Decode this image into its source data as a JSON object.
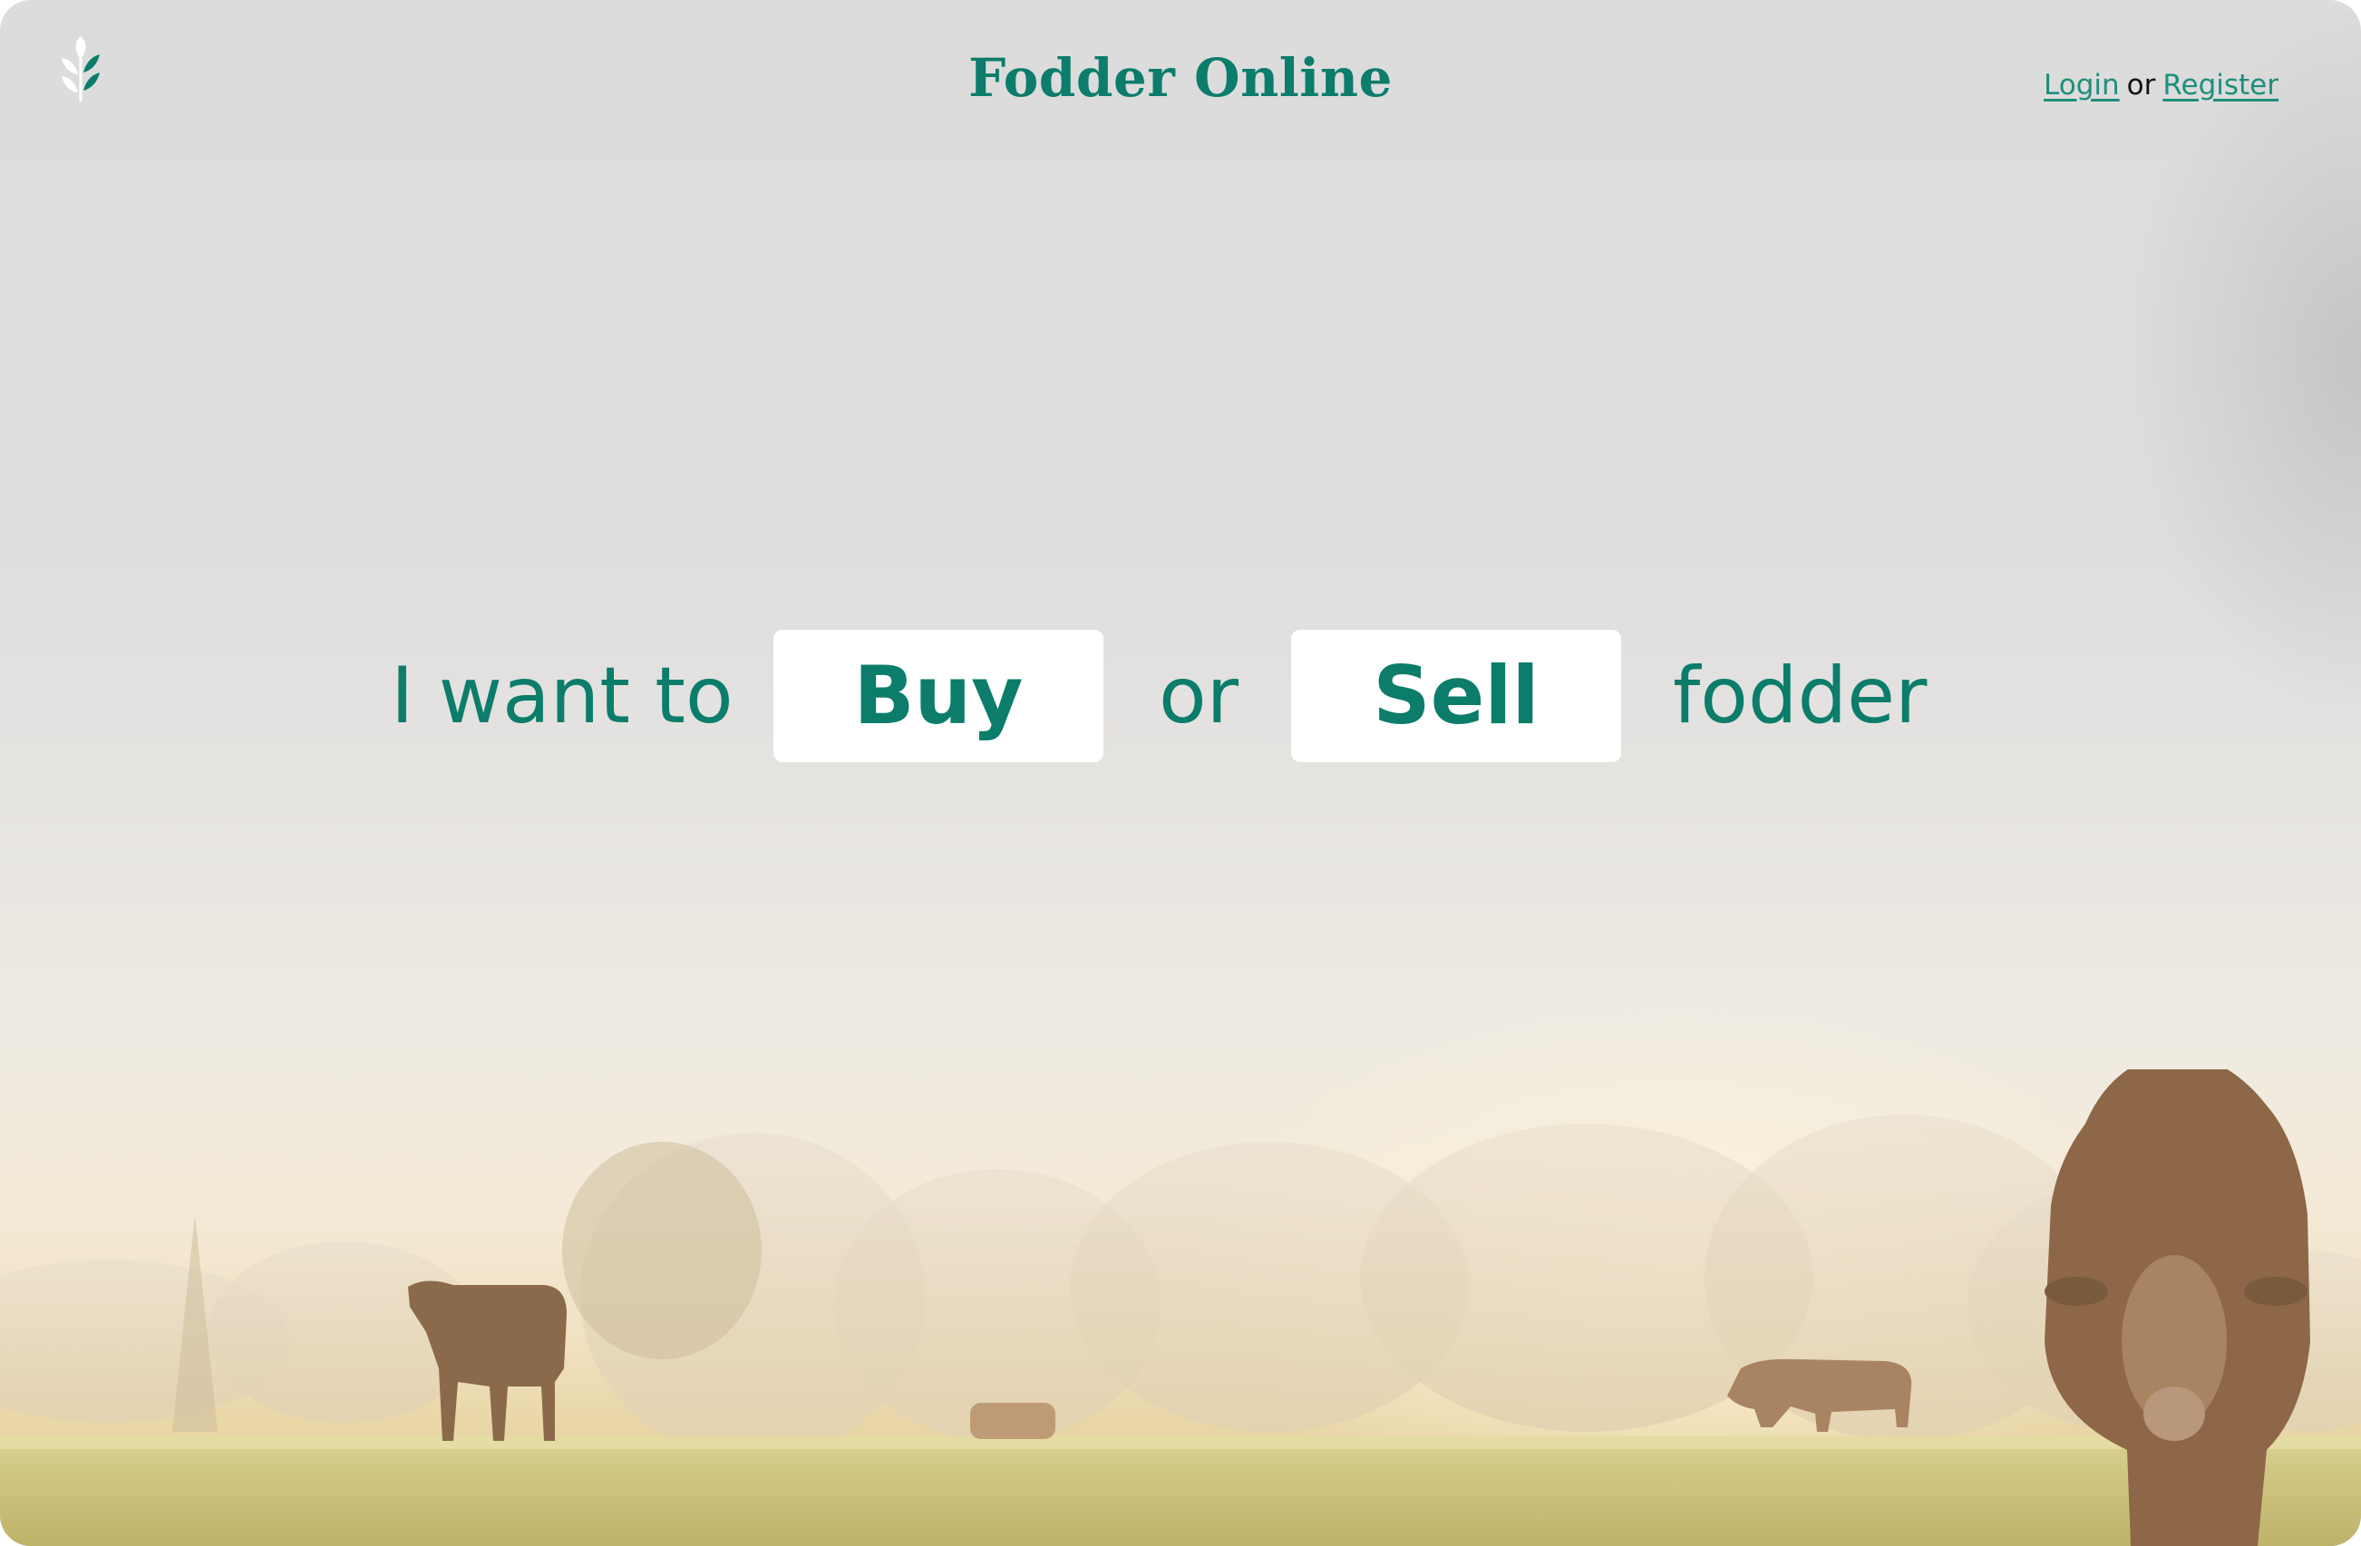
{
  "header": {
    "brand": "Fodder Online",
    "login_label": "Login",
    "or_label": "or",
    "register_label": "Register"
  },
  "hero": {
    "prefix": "I want to",
    "buy_label": "Buy",
    "or_label": "or",
    "sell_label": "Sell",
    "suffix": "fodder"
  },
  "icons": {
    "logo": "wheat-leaf-icon"
  },
  "colors": {
    "accent": "#0b7d6a",
    "link": "#1d8f7c",
    "button_bg": "#ffffff"
  }
}
